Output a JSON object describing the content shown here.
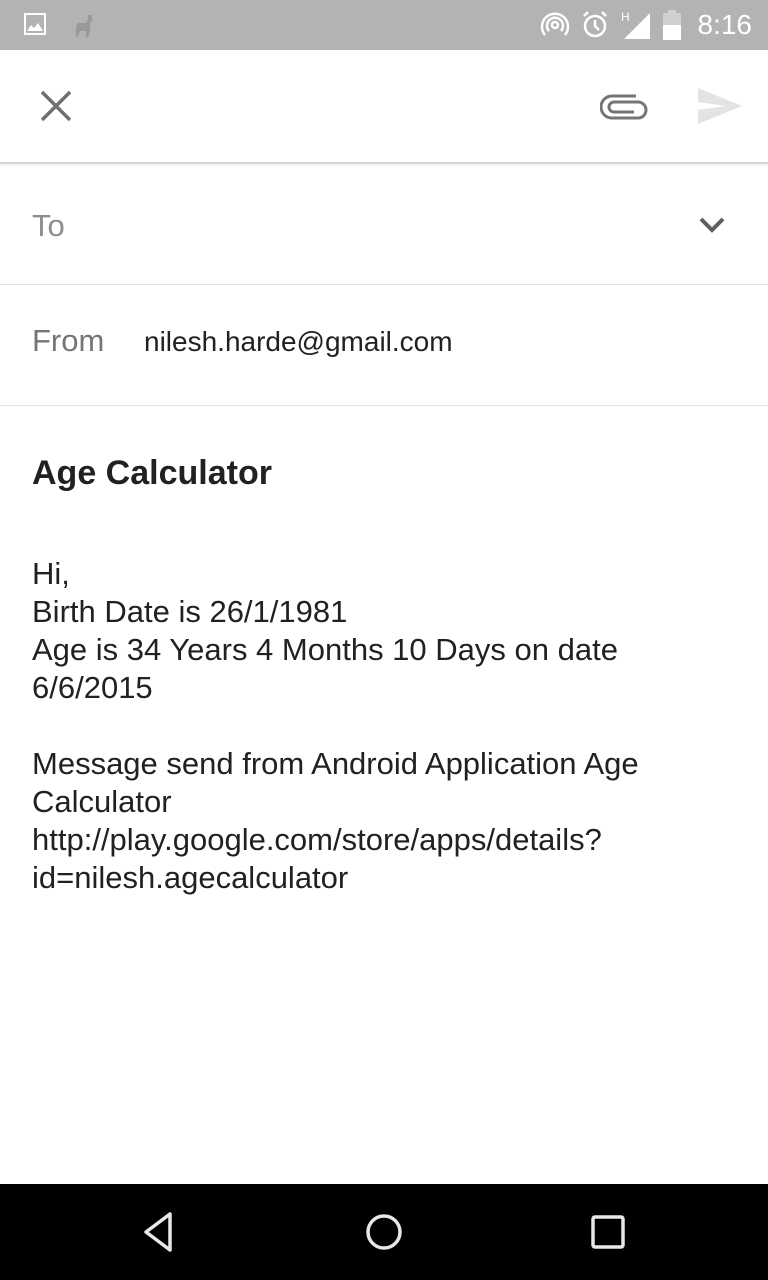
{
  "status_bar": {
    "time": "8:16",
    "left_icons": [
      "image-notification-icon",
      "llama-notification-icon"
    ],
    "right_icons": [
      "hotspot-icon",
      "alarm-icon",
      "signal-h-icon",
      "battery-icon"
    ],
    "network_type": "H",
    "background_color": "#b3b3b3"
  },
  "toolbar": {
    "close_icon": "close-icon",
    "attach_icon": "paperclip-icon",
    "send_icon": "send-icon"
  },
  "compose": {
    "to_label": "To",
    "to_value": "",
    "from_label": "From",
    "from_value": "nilesh.harde@gmail.com",
    "subject": "Age Calculator",
    "body_lines": [
      "Hi,",
      "Birth Date is 26/1/1981",
      "Age is 34 Years 4 Months 10 Days on date",
      "6/6/2015",
      "",
      "Message send from Android Application Age",
      "Calculator",
      "http://play.google.com/store/apps/details?",
      "id=nilesh.agecalculator"
    ]
  },
  "nav_bar": {
    "back_icon": "back-icon",
    "home_icon": "home-icon",
    "recents_icon": "recents-icon"
  }
}
